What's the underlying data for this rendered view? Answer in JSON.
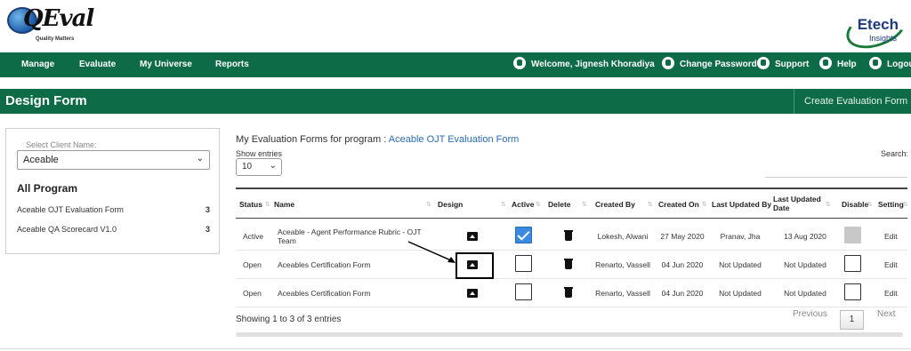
{
  "brand": {
    "left_logo_text": "QEval",
    "left_tagline": "Quality Matters",
    "right_logo_line1": "Etech",
    "right_logo_line2": "Insights"
  },
  "nav": {
    "items": [
      "Manage",
      "Evaluate",
      "My Universe",
      "Reports"
    ],
    "welcome": "Welcome, Jignesh Khoradiya",
    "change_password": "Change Password",
    "support": "Support",
    "help": "Help",
    "logout": "Logout"
  },
  "title": "Design Form",
  "create_button": "Create Evaluation Form",
  "client": {
    "label": "Select Client Name:",
    "value": "Aceable"
  },
  "programs": {
    "heading": "All Program",
    "items": [
      {
        "name": "Aceable OJT Evaluation Form",
        "count": "3"
      },
      {
        "name": "Aceable QA Scorecard V1.0",
        "count": "3"
      }
    ]
  },
  "content": {
    "heading_prefix": "My Evaluation Forms for program : ",
    "heading_program": "Aceable OJT Evaluation Form",
    "show_entries": "Show entries",
    "entries_value": "10",
    "search_label": "Search:"
  },
  "table": {
    "headers": {
      "status": "Status",
      "name": "Name",
      "design": "Design",
      "active": "Active",
      "delete": "Delete",
      "created_by": "Created By",
      "created_on": "Created On",
      "last_updated_by": "Last Updated By",
      "last_updated_date": "Last Updated Date",
      "disable": "Disable",
      "setting": "Setting"
    },
    "rows": [
      {
        "status": "Active",
        "name": "Aceable - Agent Performance Rubric - OJT Team",
        "active": true,
        "created_by": "Lokesh, Alwani",
        "created_on": "27 May 2020",
        "last_updated_by": "Pranav, Jha",
        "last_updated_date": "13 Aug 2020",
        "disable": "grey",
        "setting": "Edit"
      },
      {
        "status": "Open",
        "name": "Aceables Certification Form",
        "active": false,
        "created_by": "Renarto, Vassell",
        "created_on": "04 Jun 2020",
        "last_updated_by": "Not Updated",
        "last_updated_date": "Not Updated",
        "disable": "empty",
        "setting": "Edit"
      },
      {
        "status": "Open",
        "name": "Aceables Certification Form",
        "active": false,
        "created_by": "Renarto, Vassell",
        "created_on": "04 Jun 2020",
        "last_updated_by": "Not Updated",
        "last_updated_date": "Not Updated",
        "disable": "empty",
        "setting": "Edit"
      }
    ]
  },
  "footer": {
    "info": "Showing 1 to 3 of 3 entries",
    "previous": "Previous",
    "page": "1",
    "next": "Next"
  }
}
